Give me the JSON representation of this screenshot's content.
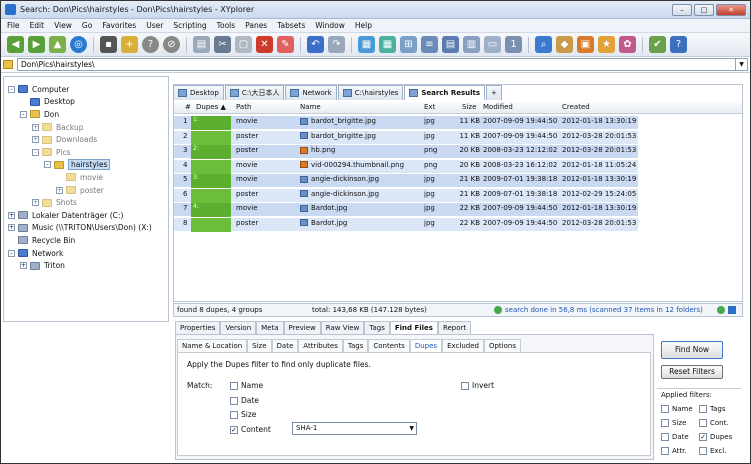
{
  "window": {
    "title": "Search: Don\\Pics\\hairstyles - Don\\Pics\\hairstyles - XYplorer"
  },
  "menu": [
    "File",
    "Edit",
    "View",
    "Go",
    "Favorites",
    "User",
    "Scripting",
    "Tools",
    "Panes",
    "Tabsets",
    "Window",
    "Help"
  ],
  "address": {
    "path": "Don\\Pics\\hairstyles\\"
  },
  "tree": [
    {
      "label": "Computer",
      "indent": 0,
      "pm": "-",
      "icon": "c"
    },
    {
      "label": "Desktop",
      "indent": 1,
      "pm": "",
      "icon": "c"
    },
    {
      "label": "Don",
      "indent": 1,
      "pm": "-",
      "icon": "f"
    },
    {
      "label": "Backup",
      "indent": 2,
      "pm": "+",
      "icon": "f",
      "dim": true
    },
    {
      "label": "Downloads",
      "indent": 2,
      "pm": "+",
      "icon": "f",
      "dim": true
    },
    {
      "label": "Pics",
      "indent": 2,
      "pm": "-",
      "icon": "f",
      "dim": true
    },
    {
      "label": "hairstyles",
      "indent": 3,
      "pm": "-",
      "icon": "f",
      "sel": true
    },
    {
      "label": "movie",
      "indent": 4,
      "pm": "",
      "icon": "f",
      "dim": true
    },
    {
      "label": "poster",
      "indent": 4,
      "pm": "+",
      "icon": "f",
      "dim": true
    },
    {
      "label": "Shots",
      "indent": 2,
      "pm": "+",
      "icon": "f",
      "dim": true
    },
    {
      "label": "Lokaler Datenträger (C:)",
      "indent": 0,
      "pm": "+",
      "icon": "d"
    },
    {
      "label": "Music (\\\\TRITON\\Users\\Don) (X:)",
      "indent": 0,
      "pm": "+",
      "icon": "d"
    },
    {
      "label": "Recycle Bin",
      "indent": 0,
      "pm": "",
      "icon": "d"
    },
    {
      "label": "Network",
      "indent": 0,
      "pm": "-",
      "icon": "c"
    },
    {
      "label": "Triton",
      "indent": 1,
      "pm": "+",
      "icon": "d"
    }
  ],
  "tabs": [
    "Desktop",
    "C:\\大日本人",
    "Network",
    "C:\\hairstyles",
    "Search Results"
  ],
  "columns": {
    "num": "#",
    "dupes": "Dupes ▲",
    "path": "Path",
    "name": "Name",
    "ext": "Ext",
    "size": "Size",
    "modified": "Modified",
    "created": "Created"
  },
  "rows": [
    {
      "n": "1",
      "g": "1:",
      "path": "movie",
      "name": "bardot_brigitte.jpg",
      "ext": "jpg",
      "size": "11 KB",
      "mod": "2007-09-09 19:44:50",
      "cre": "2012-01-18 13:30:19",
      "type": "jpg"
    },
    {
      "n": "2",
      "g": "",
      "path": "poster",
      "name": "bardot_brigitte.jpg",
      "ext": "jpg",
      "size": "11 KB",
      "mod": "2007-09-09 19:44:50",
      "cre": "2012-03-28 20:01:53",
      "type": "jpg"
    },
    {
      "n": "3",
      "g": "2:",
      "path": "poster",
      "name": "hb.png",
      "ext": "png",
      "size": "20 KB",
      "mod": "2008-03-23 12:12:02",
      "cre": "2012-03-28 20:01:53",
      "type": "png"
    },
    {
      "n": "4",
      "g": "",
      "path": "movie",
      "name": "vid-000294.thumbnail.png",
      "ext": "png",
      "size": "20 KB",
      "mod": "2008-03-23 16:12:02",
      "cre": "2012-01-18 11:05:24",
      "type": "png"
    },
    {
      "n": "5",
      "g": "3:",
      "path": "movie",
      "name": "angie-dickinson.jpg",
      "ext": "jpg",
      "size": "21 KB",
      "mod": "2009-07-01 19:38:18",
      "cre": "2012-01-18 13:30:19",
      "type": "jpg"
    },
    {
      "n": "6",
      "g": "",
      "path": "poster",
      "name": "angie-dickinson.jpg",
      "ext": "jpg",
      "size": "21 KB",
      "mod": "2009-07-01 19:38:18",
      "cre": "2012-02-29 15:24:05",
      "type": "jpg"
    },
    {
      "n": "7",
      "g": "4:",
      "path": "movie",
      "name": "Bardot.jpg",
      "ext": "jpg",
      "size": "22 KB",
      "mod": "2007-09-09 19:44:50",
      "cre": "2012-01-18 13:30:19",
      "type": "jpg"
    },
    {
      "n": "8",
      "g": "",
      "path": "poster",
      "name": "Bardot.jpg",
      "ext": "jpg",
      "size": "22 KB",
      "mod": "2007-09-09 19:44:50",
      "cre": "2012-03-28 20:01:53",
      "type": "jpg"
    }
  ],
  "status": {
    "left": "found 8 dupes, 4 groups",
    "mid": "total: 143,68 KB (147.128 bytes)",
    "right": "search done in 56,8 ms (scanned 37 items in 12 folders)"
  },
  "infotabs": [
    "Properties",
    "Version",
    "Meta",
    "Preview",
    "Raw View",
    "Tags",
    "Find Files",
    "Report"
  ],
  "subtabs": [
    "Name & Location",
    "Size",
    "Date",
    "Attributes",
    "Tags",
    "Contents",
    "Dupes",
    "Excluded",
    "Options"
  ],
  "dupes": {
    "hint": "Apply the Dupes filter to find only duplicate files.",
    "match_label": "Match:",
    "name": "Name",
    "date": "Date",
    "size": "Size",
    "content": "Content",
    "invert": "Invert",
    "hash": "SHA-1"
  },
  "buttons": {
    "find_now": "Find Now",
    "reset": "Reset Filters"
  },
  "applied": {
    "title": "Applied filters:",
    "name": "Name",
    "tags": "Tags",
    "size": "Size",
    "cont": "Cont.",
    "date": "Date",
    "dupes": "Dupes",
    "attr": "Attr.",
    "excl": "Excl."
  }
}
